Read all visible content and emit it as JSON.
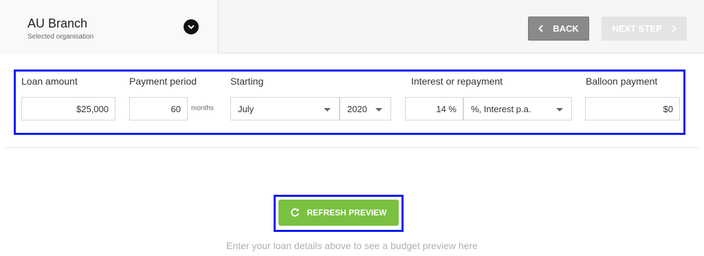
{
  "organisation": {
    "name": "AU Branch",
    "subtitle": "Selected organisation"
  },
  "nav": {
    "back_label": "BACK",
    "next_label": "NEXT STEP"
  },
  "form": {
    "loan_amount": {
      "label": "Loan amount",
      "value": "$25,000"
    },
    "payment_period": {
      "label": "Payment period",
      "value": "60",
      "unit": "months"
    },
    "starting": {
      "label": "Starting",
      "month": "July",
      "year": "2020"
    },
    "interest": {
      "label": "Interest or repayment",
      "value": "14 %",
      "type": "%, Interest p.a."
    },
    "balloon": {
      "label": "Balloon payment",
      "value": "$0"
    }
  },
  "preview": {
    "refresh_label": "REFRESH PREVIEW",
    "hint": "Enter your loan details above to see a budget preview here"
  },
  "colors": {
    "accent_green": "#7ac142",
    "highlight_blue": "#0b1cf0",
    "back_gray": "#8a8a8a"
  }
}
